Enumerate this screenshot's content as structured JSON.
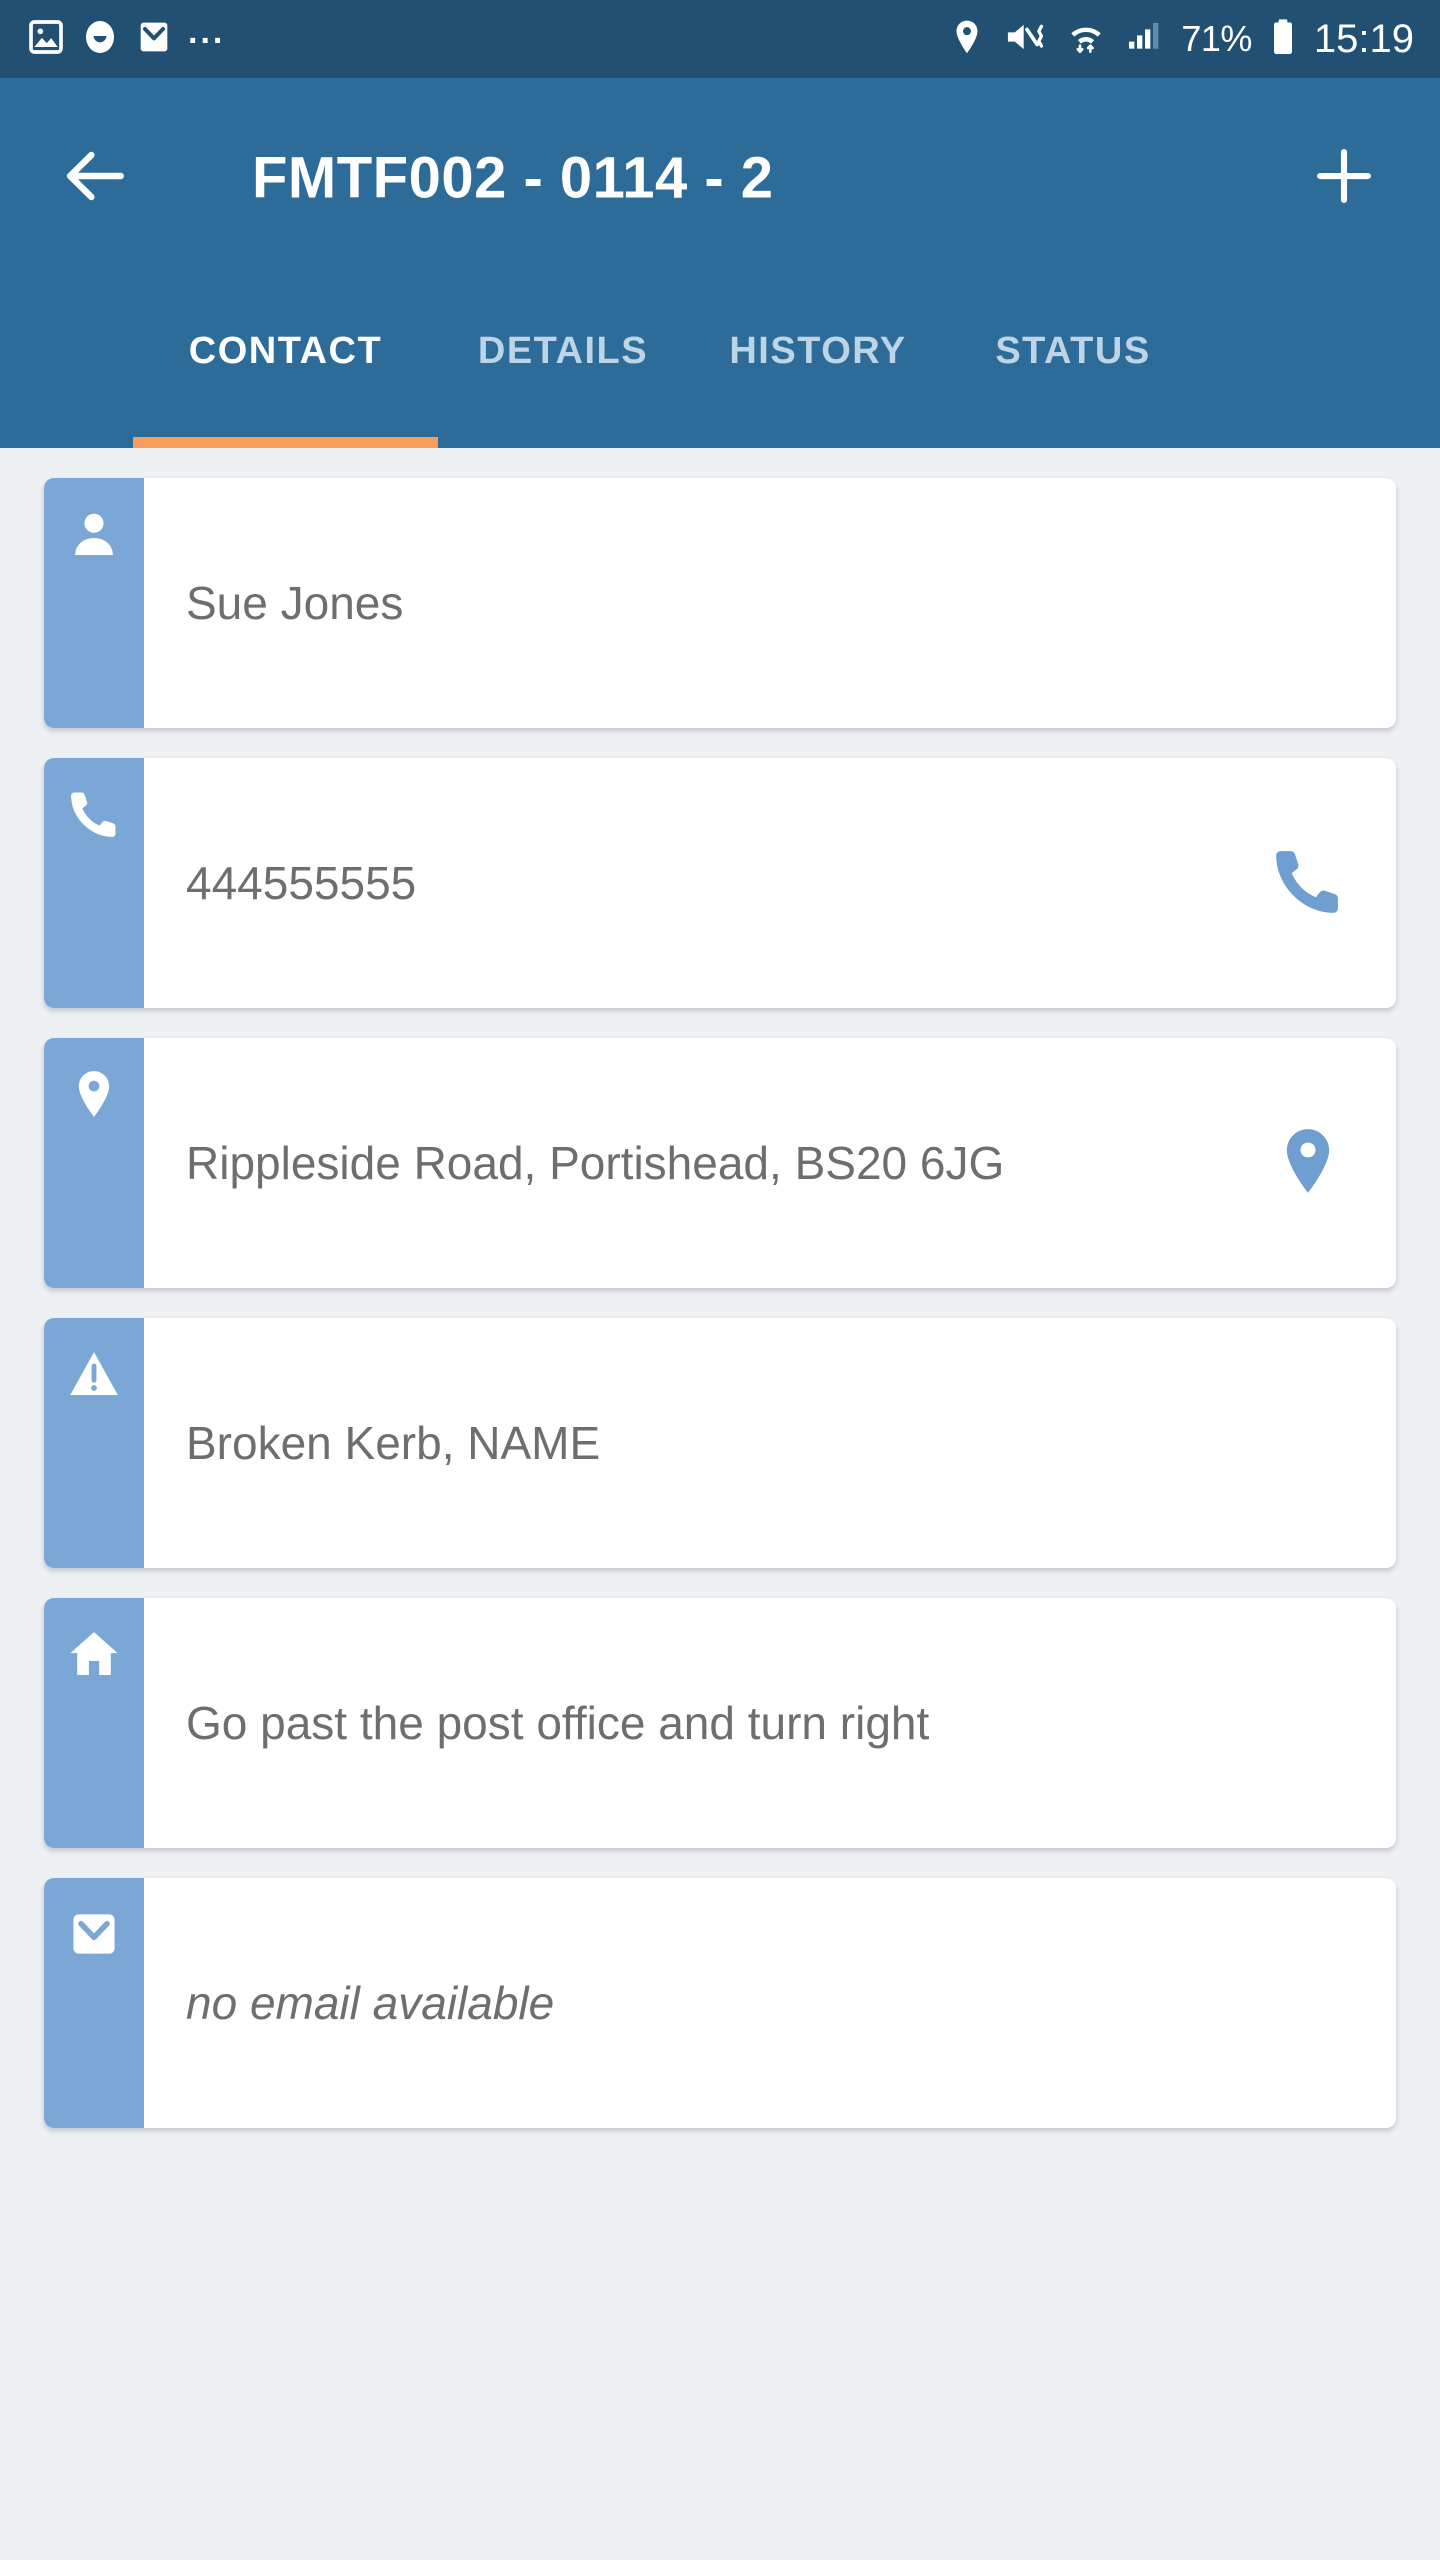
{
  "colors": {
    "status_bar": "#215072",
    "app_bar": "#2d6c99",
    "tab_indicator": "#f89d5a",
    "strip": "#7ba7d6",
    "action_icon": "#6f9fd0",
    "page_background": "#eef1f4",
    "card_background": "#ffffff",
    "card_text": "#6e6e6e"
  },
  "status_bar": {
    "left_icons": [
      "image-icon",
      "smiley-icon",
      "mail-icon"
    ],
    "overflow": "...",
    "right_icons": [
      "location-icon",
      "mute-vibrate-icon",
      "wifi-icon",
      "signal-icon",
      "battery-icon"
    ],
    "battery_percent": "71%",
    "clock": "15:19"
  },
  "app_bar": {
    "back_icon": "arrow-left-icon",
    "title": "FMTF002 - 0114 - 2",
    "add_icon": "plus-icon",
    "tabs": [
      {
        "label": "CONTACT",
        "active": true
      },
      {
        "label": "DETAILS",
        "active": false
      },
      {
        "label": "HISTORY",
        "active": false
      },
      {
        "label": "STATUS",
        "active": false
      }
    ]
  },
  "cards": [
    {
      "icon": "person-icon",
      "text": "Sue Jones",
      "italic": false,
      "action_icon": null
    },
    {
      "icon": "phone-icon",
      "text": "444555555",
      "italic": false,
      "action_icon": "call-icon"
    },
    {
      "icon": "location-pin-icon",
      "text": "Rippleside Road, Portishead, BS20 6JG",
      "italic": false,
      "action_icon": "map-pin-icon"
    },
    {
      "icon": "warning-icon",
      "text": "Broken Kerb, NAME",
      "italic": false,
      "action_icon": null
    },
    {
      "icon": "home-icon",
      "text": "Go past the post office and turn right",
      "italic": false,
      "action_icon": null
    },
    {
      "icon": "envelope-icon",
      "text": "no email available",
      "italic": true,
      "action_icon": null
    }
  ]
}
